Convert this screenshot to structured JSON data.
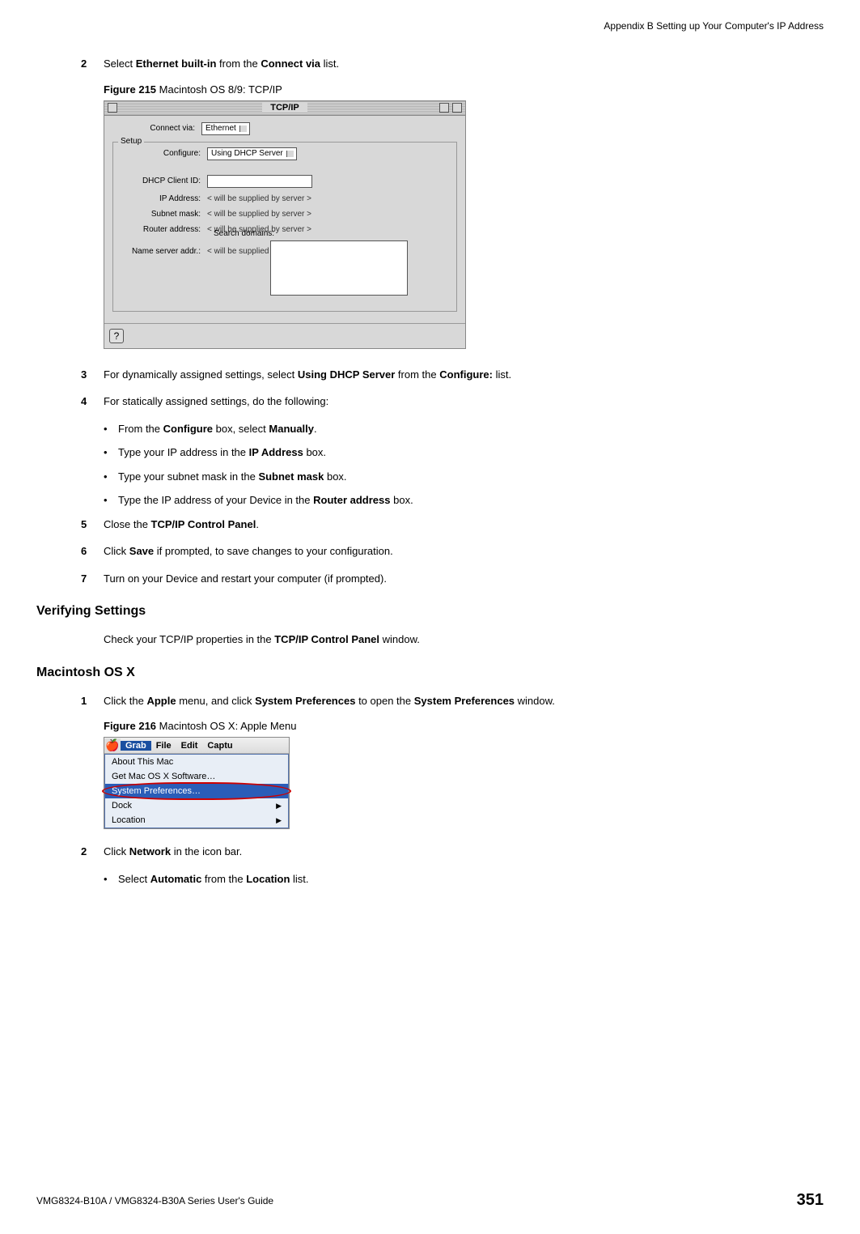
{
  "header": {
    "section_title": "Appendix B Setting up Your Computer's IP Address"
  },
  "steps": {
    "s2": {
      "num": "2",
      "pre": "Select ",
      "b1": "Ethernet built-in",
      "mid": " from the ",
      "b2": "Connect via",
      "post": " list."
    },
    "fig215": {
      "label": "Figure 215",
      "caption": "   Macintosh OS 8/9: TCP/IP"
    },
    "s3": {
      "num": "3",
      "pre": "For dynamically assigned settings, select ",
      "b1": "Using DHCP Server",
      "mid": " from the ",
      "b2": "Configure:",
      "post": " list."
    },
    "s4": {
      "num": "4",
      "text": "For statically assigned settings, do the following:"
    },
    "s4b1": {
      "pre": "From the ",
      "b": "Configure",
      "post": " box, select ",
      "b2": "Manually",
      "post2": "."
    },
    "s4b2": {
      "pre": "Type your IP address in the ",
      "b": "IP Address",
      "post": " box."
    },
    "s4b3": {
      "pre": "Type your subnet mask in the ",
      "b": "Subnet mask",
      "post": " box."
    },
    "s4b4": {
      "pre": "Type the IP address of your Device in the ",
      "b": "Router address",
      "post": " box."
    },
    "s5": {
      "num": "5",
      "pre": "Close the ",
      "b": "TCP/IP Control Panel",
      "post": "."
    },
    "s6": {
      "num": "6",
      "pre": "Click ",
      "b": "Save",
      "post": " if prompted, to save changes to your configuration."
    },
    "s7": {
      "num": "7",
      "text": "Turn on your Device and restart your computer (if prompted)."
    }
  },
  "verifying": {
    "heading": "Verifying Settings",
    "para_pre": "Check your TCP/IP properties in the ",
    "para_b": "TCP/IP Control Panel",
    "para_post": " window."
  },
  "osx": {
    "heading": "Macintosh OS X",
    "s1": {
      "num": "1",
      "pre": "Click the ",
      "b1": "Apple",
      "mid1": " menu, and click ",
      "b2": "System Preferences",
      "mid2": " to open the ",
      "b3": "System Preferences",
      "post": " window."
    },
    "fig216": {
      "label": "Figure 216",
      "caption": "   Macintosh OS X: Apple Menu"
    },
    "s2": {
      "num": "2",
      "pre": "Click ",
      "b": "Network",
      "post": " in the icon bar."
    },
    "s2b1": {
      "pre": "Select ",
      "b1": "Automatic",
      "mid": " from the ",
      "b2": "Location",
      "post": " list."
    }
  },
  "tcpip_dialog": {
    "title": "TCP/IP",
    "connect_via_label": "Connect via:",
    "connect_via_value": "Ethernet",
    "setup_label": "Setup",
    "configure_label": "Configure:",
    "configure_value": "Using DHCP Server",
    "dhcp_client_label": "DHCP Client ID:",
    "ip_address_label": "IP Address:",
    "subnet_label": "Subnet mask:",
    "router_label": "Router address:",
    "supplied_text": "< will be supplied by server >",
    "name_server_label": "Name server addr.:",
    "search_domains_label": "Search domains:",
    "help_symbol": "?"
  },
  "apple_menu": {
    "menubar": {
      "grab": "Grab",
      "file": "File",
      "edit": "Edit",
      "captu": "Captu"
    },
    "items": {
      "about": "About This Mac",
      "getsoft": "Get Mac OS X Software…",
      "sysprefs": "System Preferences…",
      "dock": "Dock",
      "location": "Location"
    },
    "arrow": "▶"
  },
  "footer": {
    "guide": "VMG8324-B10A / VMG8324-B30A Series User's Guide",
    "page": "351"
  }
}
